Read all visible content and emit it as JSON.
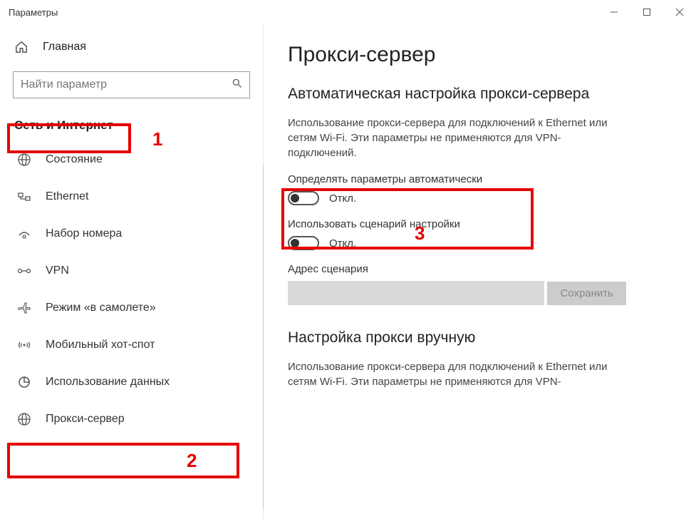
{
  "titlebar": {
    "title": "Параметры"
  },
  "sidebar": {
    "home_label": "Главная",
    "search_placeholder": "Найти параметр",
    "category": "Сеть и Интернет",
    "items": [
      {
        "label": "Состояние"
      },
      {
        "label": "Ethernet"
      },
      {
        "label": "Набор номера"
      },
      {
        "label": "VPN"
      },
      {
        "label": "Режим «в самолете»"
      },
      {
        "label": "Мобильный хот-спот"
      },
      {
        "label": "Использование данных"
      },
      {
        "label": "Прокси-сервер"
      }
    ]
  },
  "main": {
    "title": "Прокси-сервер",
    "auto_section": "Автоматическая настройка прокси-сервера",
    "auto_desc": "Использование прокси-сервера для подключений к Ethernet или сетям Wi-Fi. Эти параметры не применяются для VPN-подключений.",
    "auto_detect_label": "Определять параметры автоматически",
    "toggle_off_label": "Откл.",
    "use_script_label": "Использовать сценарий настройки",
    "script_address_label": "Адрес сценария",
    "script_address_value": "",
    "save_label": "Сохранить",
    "manual_section": "Настройка прокси вручную",
    "manual_desc": "Использование прокси-сервера для подключений к Ethernet или сетям Wi-Fi. Эти параметры не применяются для VPN-"
  },
  "annotations": {
    "n1": "1",
    "n2": "2",
    "n3": "3"
  }
}
